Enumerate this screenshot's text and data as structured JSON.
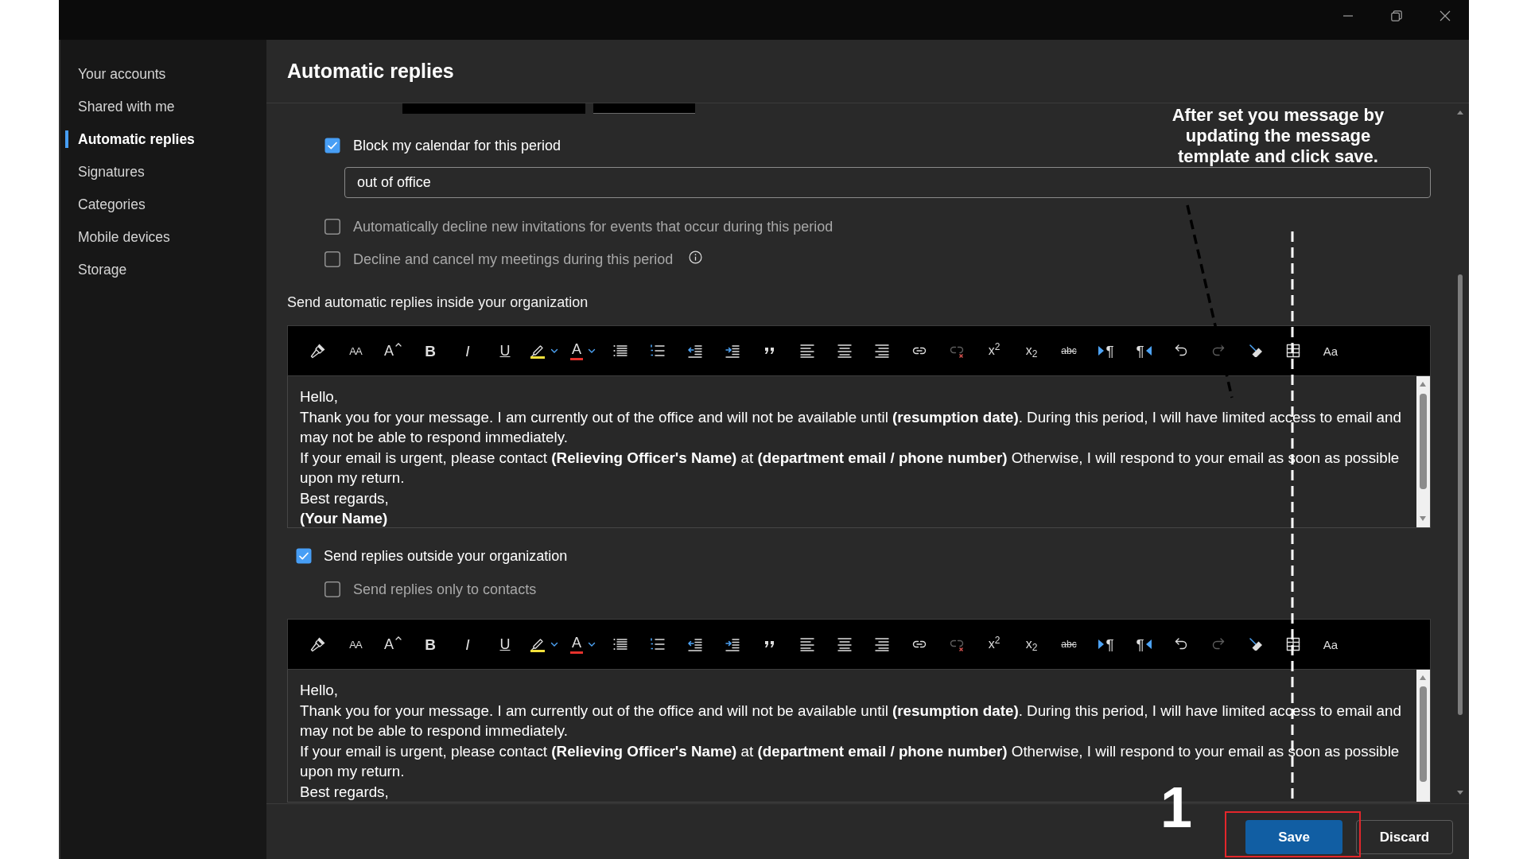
{
  "sidebar": {
    "items": [
      {
        "label": "Your accounts",
        "selected": false
      },
      {
        "label": "Shared with me",
        "selected": false
      },
      {
        "label": "Automatic replies",
        "selected": true
      },
      {
        "label": "Signatures",
        "selected": false
      },
      {
        "label": "Categories",
        "selected": false
      },
      {
        "label": "Mobile devices",
        "selected": false
      },
      {
        "label": "Storage",
        "selected": false
      }
    ]
  },
  "page": {
    "title": "Automatic replies"
  },
  "calendar_block": {
    "label": "Block my calendar for this period",
    "checked": true,
    "event_name": "out of office"
  },
  "meeting_options": [
    {
      "label": "Automatically decline new invitations for events that occur during this period",
      "checked": false
    },
    {
      "label": "Decline and cancel my meetings during this period",
      "checked": false,
      "info": true
    }
  ],
  "inside_organization": {
    "heading": "Send automatic replies inside your organization",
    "editor": {
      "toolbar": [
        {
          "kind": "painter",
          "disabled": false
        },
        {
          "kind": "fontsize",
          "text": "AA",
          "disabled": false
        },
        {
          "kind": "grow",
          "text": "A",
          "disabled": false
        },
        {
          "kind": "bold",
          "text": "B",
          "disabled": false
        },
        {
          "kind": "italic",
          "text": "I",
          "disabled": false
        },
        {
          "kind": "underline",
          "text": "U",
          "disabled": false
        },
        {
          "kind": "highlight",
          "disabled": false
        },
        {
          "kind": "fontcolor",
          "text": "A",
          "disabled": false
        },
        {
          "kind": "bullets",
          "disabled": false
        },
        {
          "kind": "numbering",
          "disabled": false
        },
        {
          "kind": "outdent",
          "disabled": false
        },
        {
          "kind": "indent",
          "disabled": false
        },
        {
          "kind": "quote",
          "disabled": false
        },
        {
          "kind": "left",
          "disabled": false
        },
        {
          "kind": "center",
          "disabled": false
        },
        {
          "kind": "right",
          "disabled": false
        },
        {
          "kind": "link",
          "disabled": false
        },
        {
          "kind": "unlink",
          "disabled": true
        },
        {
          "kind": "superscript",
          "text": "x$^{2}$",
          "disabled": false
        },
        {
          "kind": "subscript",
          "text": "x$_{2}$",
          "disabled": false
        },
        {
          "kind": "strike",
          "text": "abc",
          "disabled": false
        },
        {
          "kind": "ltr",
          "text": "¶",
          "disabled": false
        },
        {
          "kind": "rtl",
          "text": "¶",
          "disabled": false
        },
        {
          "kind": "undo",
          "disabled": false
        },
        {
          "kind": "redo",
          "disabled": true
        },
        {
          "kind": "clear",
          "disabled": false
        },
        {
          "kind": "table",
          "disabled": false
        },
        {
          "kind": "styles",
          "text": "Aa",
          "disabled": false
        }
      ],
      "lines": [
        {
          "text": "Hello,",
          "bold": false
        },
        {
          "text": "Thank you for your message. I am currently out of the office and will not be available until **(resumption date)**. During this period, I will have limited access to email and may not be able to respond immediately.",
          "bold": false
        },
        {
          "text": "If your email is urgent, please contact **(Relieving Officer's Name)** at **(department email / phone number)** Otherwise, I will respond to your email as soon as possible upon my return.",
          "bold": false
        },
        {
          "text": "Best regards,",
          "bold": false
        },
        {
          "text": "(Your Name)",
          "bold": true
        }
      ]
    }
  },
  "outside_organization": {
    "label": "Send replies outside your organization",
    "checked": true,
    "contacts_only": {
      "label": "Send replies only to contacts",
      "checked": false
    },
    "editor": {
      "toolbar": [
        {
          "kind": "painter",
          "disabled": false
        },
        {
          "kind": "fontsize",
          "text": "AA",
          "disabled": false
        },
        {
          "kind": "grow",
          "text": "A",
          "disabled": false
        },
        {
          "kind": "bold",
          "text": "B",
          "disabled": false
        },
        {
          "kind": "italic",
          "text": "I",
          "disabled": false
        },
        {
          "kind": "underline",
          "text": "U",
          "disabled": false
        },
        {
          "kind": "highlight",
          "disabled": false
        },
        {
          "kind": "fontcolor",
          "text": "A",
          "disabled": false
        },
        {
          "kind": "bullets",
          "disabled": false
        },
        {
          "kind": "numbering",
          "disabled": false
        },
        {
          "kind": "outdent",
          "disabled": false
        },
        {
          "kind": "indent",
          "disabled": false
        },
        {
          "kind": "quote",
          "disabled": false
        },
        {
          "kind": "left",
          "disabled": false
        },
        {
          "kind": "center",
          "disabled": false
        },
        {
          "kind": "right",
          "disabled": false
        },
        {
          "kind": "link",
          "disabled": false
        },
        {
          "kind": "unlink",
          "disabled": true
        },
        {
          "kind": "superscript",
          "text": "x$^{2}$",
          "disabled": false
        },
        {
          "kind": "subscript",
          "text": "x$_{2}$",
          "disabled": false
        },
        {
          "kind": "strike",
          "text": "abc",
          "disabled": false
        },
        {
          "kind": "ltr",
          "text": "¶",
          "disabled": false
        },
        {
          "kind": "rtl",
          "text": "¶",
          "disabled": false
        },
        {
          "kind": "undo",
          "disabled": false
        },
        {
          "kind": "redo",
          "disabled": true
        },
        {
          "kind": "clear",
          "disabled": false
        },
        {
          "kind": "table",
          "disabled": false
        },
        {
          "kind": "styles",
          "text": "Aa",
          "disabled": false
        }
      ],
      "lines": [
        {
          "text": "Hello,",
          "bold": false
        },
        {
          "text": "Thank you for your message. I am currently out of the office and will not be available until **(resumption date)**. During this period, I will have limited access to email and may not be able to respond immediately.",
          "bold": false
        },
        {
          "text": "If your email is urgent, please contact **(Relieving Officer's Name)** at **(department email / phone number)** Otherwise, I will respond to your email as soon as possible upon my return.",
          "bold": false
        },
        {
          "text": "Best regards,",
          "bold": false
        }
      ]
    }
  },
  "footer": {
    "buttons": [
      {
        "label": "Save",
        "kind": "primary"
      },
      {
        "label": "Discard",
        "kind": "secondary"
      }
    ]
  },
  "annotation": {
    "note": "After set you message by updating the message template and click save.",
    "step": "1"
  }
}
